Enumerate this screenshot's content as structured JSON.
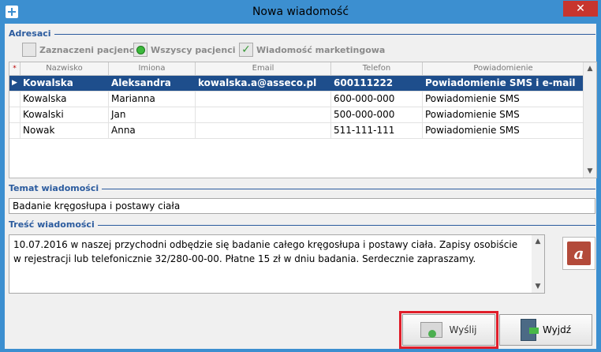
{
  "window": {
    "title": "Nowa wiadomość",
    "close_label": "✕"
  },
  "adresaci": {
    "label": "Adresaci",
    "options": [
      {
        "label": "Zaznaczeni pacjenci",
        "type": "checkbox",
        "checked": false
      },
      {
        "label": "Wszyscy pacjenci",
        "type": "radio",
        "checked": true
      },
      {
        "label": "Wiadomość marketingowa",
        "type": "checkbox",
        "checked": true
      }
    ]
  },
  "grid": {
    "indicator_header": "*",
    "columns": [
      "Nazwisko",
      "Imiona",
      "Email",
      "Telefon",
      "Powiadomienie"
    ],
    "rows": [
      {
        "nazwisko": "Kowalska",
        "imiona": "Aleksandra",
        "email": "kowalska.a@asseco.pl",
        "telefon": "600111222",
        "powiadomienie": "Powiadomienie SMS i e-mail",
        "selected": true,
        "marker": "▶"
      },
      {
        "nazwisko": "Kowalska",
        "imiona": "Marianna",
        "email": "",
        "telefon": "600-000-000",
        "powiadomienie": "Powiadomienie SMS",
        "selected": false,
        "marker": ""
      },
      {
        "nazwisko": "Kowalski",
        "imiona": "Jan",
        "email": "",
        "telefon": "500-000-000",
        "powiadomienie": "Powiadomienie SMS",
        "selected": false,
        "marker": ""
      },
      {
        "nazwisko": "Nowak",
        "imiona": "Anna",
        "email": "",
        "telefon": "511-111-111",
        "powiadomienie": "Powiadomienie SMS",
        "selected": false,
        "marker": ""
      }
    ]
  },
  "temat": {
    "label": "Temat wiadomości",
    "value": "Badanie kręgosłupa i postawy ciała"
  },
  "tresc": {
    "label": "Treść wiadomości",
    "value": "10.07.2016 w naszej przychodni odbędzie się badanie całego kręgosłupa i postawy ciała. Zapisy osobiście w rejestracji lub telefonicznie 32/280-00-00. Płatne 15 zł w dniu badania. Serdecznie zapraszamy."
  },
  "buttons": {
    "send": "Wyślij",
    "exit": "Wyjdź"
  },
  "colors": {
    "title_bar": "#3c8fd0",
    "group_label": "#2b5b9e",
    "selected_row": "#1e4e8c",
    "highlight_border": "#e01e2a",
    "close": "#c7352e"
  }
}
